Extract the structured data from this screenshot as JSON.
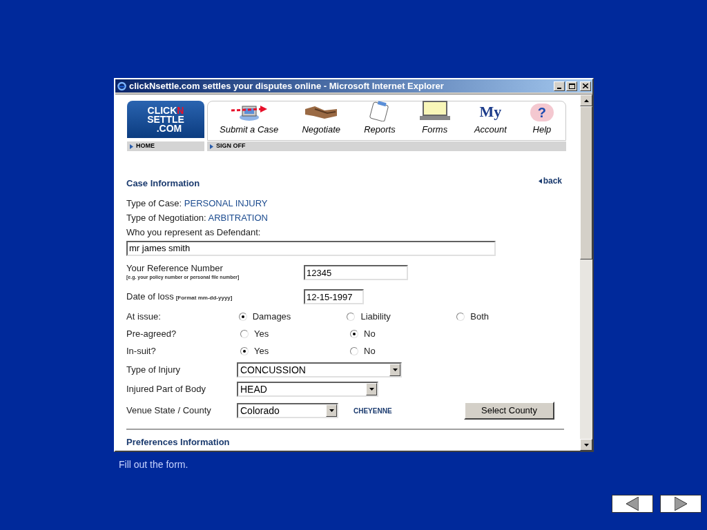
{
  "window": {
    "title": "clickNsettle.com settles your disputes online - Microsoft Internet Explorer"
  },
  "logo": {
    "parts": [
      "CLICK",
      "N",
      "SETTLE",
      ".COM"
    ]
  },
  "nav": [
    {
      "kind": "submit",
      "label": "Submit a Case"
    },
    {
      "kind": "negotiate",
      "label": "Negotiate"
    },
    {
      "kind": "reports",
      "label": "Reports"
    },
    {
      "kind": "forms",
      "label": "Forms"
    },
    {
      "kind": "account",
      "label": "Account",
      "icon_text": "My"
    },
    {
      "kind": "help",
      "label": "Help",
      "icon_text": "?"
    }
  ],
  "subnav": [
    "HOME",
    "SIGN OFF"
  ],
  "section": {
    "title": "Case Information",
    "back": "back"
  },
  "info": [
    {
      "label": "Type of Case:",
      "value": "PERSONAL INJURY"
    },
    {
      "label": "Type of Negotiation:",
      "value": "ARBITRATION"
    }
  ],
  "defendant": {
    "label": "Who you represent as Defendant:",
    "value": "mr james smith"
  },
  "reference": {
    "label": "Your Reference Number",
    "hint": "[e.g. your policy number or personal file number]",
    "value": "12345"
  },
  "date_of_loss": {
    "label": "Date of loss",
    "hint": "[Format mm-dd-yyyy]",
    "value": "12-15-1997"
  },
  "radio_rows": [
    {
      "label": "At issue:",
      "options": [
        {
          "label": "Damages",
          "selected": true
        },
        {
          "label": "Liability",
          "selected": false
        },
        {
          "label": "Both",
          "selected": false
        }
      ]
    },
    {
      "label": "Pre-agreed?",
      "options": [
        {
          "label": "Yes",
          "selected": false
        },
        {
          "label": "No",
          "selected": true
        }
      ]
    },
    {
      "label": "In-suit?",
      "options": [
        {
          "label": "Yes",
          "selected": true
        },
        {
          "label": "No",
          "selected": false
        }
      ]
    }
  ],
  "selects": [
    {
      "label": "Type of Injury",
      "value": "CONCUSSION"
    },
    {
      "label": "Injured Part of Body",
      "value": "HEAD"
    }
  ],
  "venue": {
    "label": "Venue State / County",
    "value": "Colorado",
    "county": "CHEYENNE",
    "button": "Select County"
  },
  "next_section": {
    "title": "Preferences Information"
  },
  "slide": {
    "caption": "Fill out the form.",
    "nav_buttons": [
      {
        "kind": "prev"
      },
      {
        "kind": "next"
      }
    ]
  }
}
